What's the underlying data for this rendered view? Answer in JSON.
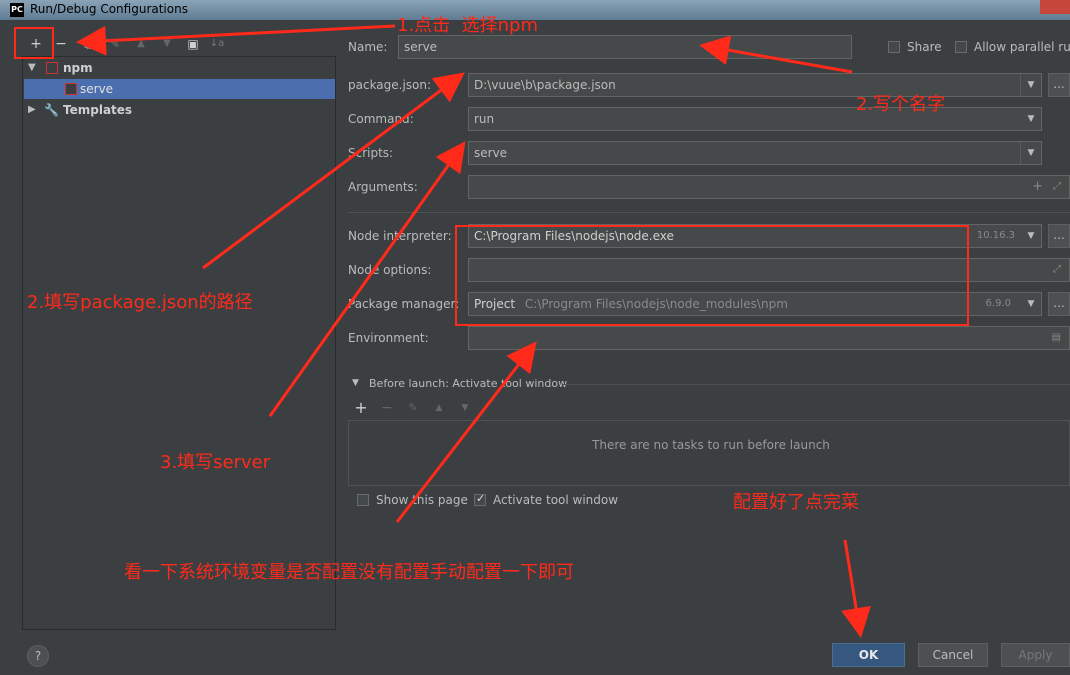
{
  "window": {
    "title": "Run/Debug Configurations",
    "logo": "PC"
  },
  "toolbar": {
    "add": "+",
    "remove": "−",
    "copy": "⎘",
    "edit": "✎",
    "up": "▲",
    "down": "▼",
    "folder": "▣",
    "sort": "↓a"
  },
  "tree": {
    "npm_label": "npm",
    "serve_label": "serve",
    "templates_label": "Templates"
  },
  "form": {
    "name_label": "Name:",
    "name_value": "serve",
    "share_label": "Share",
    "allow_parallel_label": "Allow parallel ru",
    "package_json_label": "package.json:",
    "package_json_value": "D:\\vuue\\b\\package.json",
    "command_label": "Command:",
    "command_value": "run",
    "scripts_label": "Scripts:",
    "scripts_value": "serve",
    "arguments_label": "Arguments:",
    "node_interpreter_label": "Node interpreter:",
    "node_interpreter_value": "C:\\Program Files\\nodejs\\node.exe",
    "node_version": "10.16.3",
    "node_options_label": "Node options:",
    "package_manager_label": "Package manager:",
    "package_manager_project": "Project",
    "package_manager_value": "C:\\Program Files\\nodejs\\node_modules\\npm",
    "npm_version": "6.9.0",
    "environment_label": "Environment:",
    "before_launch_label": "Before launch: Activate tool window",
    "no_tasks_text": "There are no tasks to run before launch",
    "show_page_label": "Show this page",
    "activate_tool_label": "Activate tool window",
    "browse": "..."
  },
  "buttons": {
    "ok": "OK",
    "cancel": "Cancel",
    "apply": "Apply",
    "help": "?"
  },
  "annotations": {
    "a1": "1.点击  选择npm",
    "a2_name": "2.写个名字",
    "a2_path": "2.填写package.json的路径",
    "a3": "3.填写server",
    "done": "配置好了点完菜",
    "env": "看一下系统环境变量是否配置没有配置手动配置一下即可"
  },
  "colors": {
    "annotation": "#ff2a1a",
    "selection": "#4b6eaf",
    "ok_button": "#365880"
  }
}
